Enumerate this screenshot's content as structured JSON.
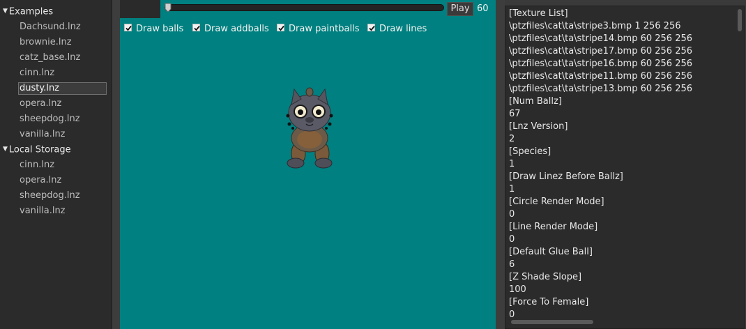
{
  "sidebar": {
    "groups": [
      {
        "label": "Examples",
        "items": [
          "Dachsund.lnz",
          "brownie.lnz",
          "catz_base.lnz",
          "cinn.lnz",
          "dusty.lnz",
          "opera.lnz",
          "sheepdog.lnz",
          "vanilla.lnz"
        ],
        "selected": "dusty.lnz"
      },
      {
        "label": "Local Storage",
        "items": [
          "cinn.lnz",
          "opera.lnz",
          "sheepdog.lnz",
          "vanilla.lnz"
        ]
      }
    ],
    "expanded_icon": "caret-down-icon"
  },
  "player": {
    "play_label": "Play",
    "fps": "60",
    "slider_position": 0
  },
  "options": [
    {
      "label": "Draw balls",
      "checked": true
    },
    {
      "label": "Draw addballs",
      "checked": true
    },
    {
      "label": "Draw paintballs",
      "checked": true
    },
    {
      "label": "Draw lines",
      "checked": true
    }
  ],
  "viewport": {
    "background": "#008080"
  },
  "file_text": [
    "[Texture List]",
    "\\ptzfiles\\cat\\ta\\stripe3.bmp 1 256 256",
    "\\ptzfiles\\cat\\ta\\stripe14.bmp 60 256 256",
    "\\ptzfiles\\cat\\ta\\stripe17.bmp 60 256 256",
    "\\ptzfiles\\cat\\ta\\stripe16.bmp 60 256 256",
    "\\ptzfiles\\cat\\ta\\stripe11.bmp 60 256 256",
    "\\ptzfiles\\cat\\ta\\stripe13.bmp 60 256 256",
    "[Num Ballz]",
    "67",
    "[Lnz Version]",
    "2",
    "[Species]",
    "1",
    "[Draw Linez Before Ballz]",
    "1",
    "[Circle Render Mode]",
    "0",
    "[Line Render Mode]",
    "0",
    "[Default Glue Ball]",
    "6",
    "[Z Shade Slope]",
    "100",
    "[Force To Female]",
    "0"
  ]
}
